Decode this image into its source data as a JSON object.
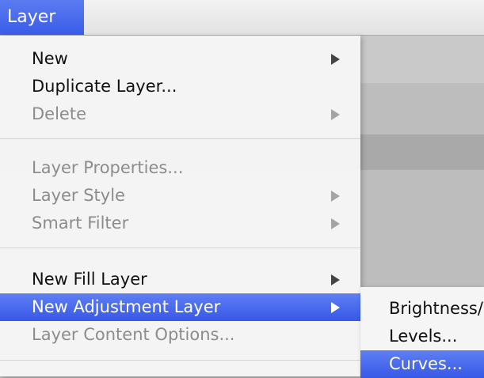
{
  "menubar": {
    "active_menu": "Layer"
  },
  "layer_menu": {
    "items": [
      {
        "label": "New",
        "enabled": true,
        "submenu": true
      },
      {
        "label": "Duplicate Layer...",
        "enabled": true,
        "submenu": false
      },
      {
        "label": "Delete",
        "enabled": false,
        "submenu": true
      },
      {
        "label": "Layer Properties...",
        "enabled": false,
        "submenu": false
      },
      {
        "label": "Layer Style",
        "enabled": false,
        "submenu": true
      },
      {
        "label": "Smart Filter",
        "enabled": false,
        "submenu": true
      },
      {
        "label": "New Fill Layer",
        "enabled": true,
        "submenu": true
      },
      {
        "label": "New Adjustment Layer",
        "enabled": true,
        "submenu": true,
        "selected": true
      },
      {
        "label": "Layer Content Options...",
        "enabled": false,
        "submenu": false
      }
    ]
  },
  "adjustment_submenu": {
    "items": [
      {
        "label": "Brightness/Contrast..."
      },
      {
        "label": "Levels..."
      },
      {
        "label": "Curves...",
        "selected": true
      }
    ]
  },
  "colors": {
    "selection": "#4a6cf0",
    "menu_background": "#f6f6f6",
    "disabled_text": "#8c8c8c"
  }
}
